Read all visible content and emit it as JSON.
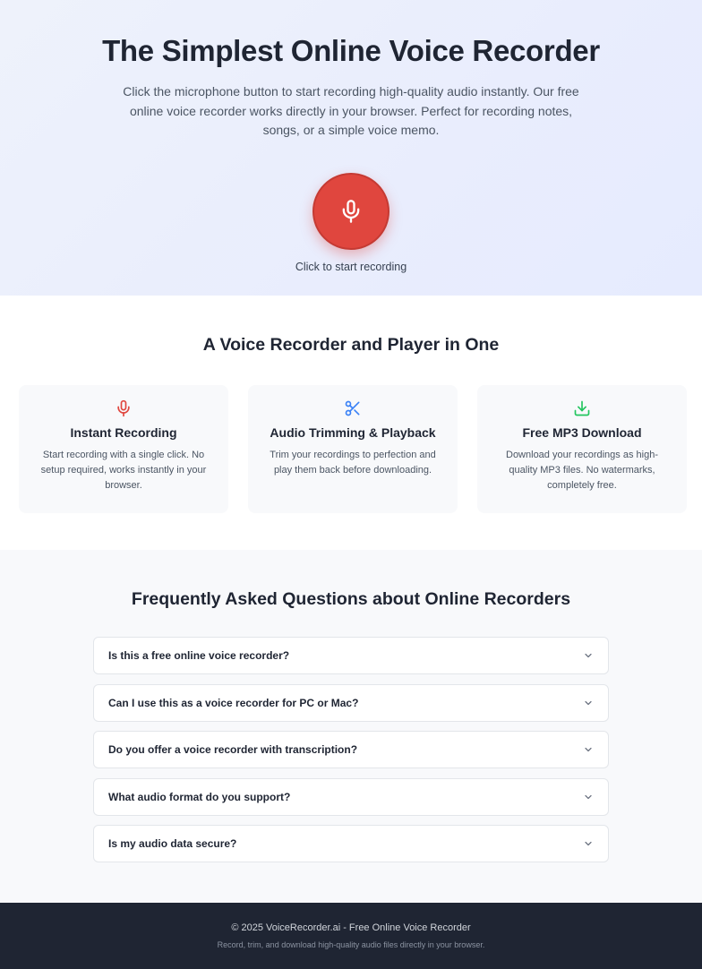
{
  "hero": {
    "title": "The Simplest Online Voice Recorder",
    "description": "Click the microphone button to start recording high-quality audio instantly. Our free online voice recorder works directly in your browser. Perfect for recording notes, songs, or a simple voice memo.",
    "record_icon": "microphone-icon",
    "record_hint": "Click to start recording"
  },
  "features": {
    "heading": "A Voice Recorder and Player in One",
    "cards": [
      {
        "icon": "microphone-icon",
        "title": "Instant Recording",
        "text": "Start recording with a single click. No setup required, works instantly in your browser."
      },
      {
        "icon": "scissors-icon",
        "title": "Audio Trimming & Playback",
        "text": "Trim your recordings to perfection and play them back before downloading."
      },
      {
        "icon": "download-icon",
        "title": "Free MP3 Download",
        "text": "Download your recordings as high-quality MP3 files. No watermarks, completely free."
      }
    ]
  },
  "faq": {
    "heading": "Frequently Asked Questions about Online Recorders",
    "items": [
      {
        "question": "Is this a free online voice recorder?"
      },
      {
        "question": "Can I use this as a voice recorder for PC or Mac?"
      },
      {
        "question": "Do you offer a voice recorder with transcription?"
      },
      {
        "question": "What audio format do you support?"
      },
      {
        "question": "Is my audio data secure?"
      }
    ]
  },
  "footer": {
    "copyright": "© 2025 VoiceRecorder.ai - Free Online Voice Recorder",
    "tagline": "Record, trim, and download high-quality audio files directly in your browser."
  },
  "colors": {
    "record_button": "#e0463e",
    "mic_icon": "#e0463e",
    "scissors_icon": "#3b82f6",
    "download_icon": "#22c55e",
    "footer_bg": "#1f2533"
  }
}
